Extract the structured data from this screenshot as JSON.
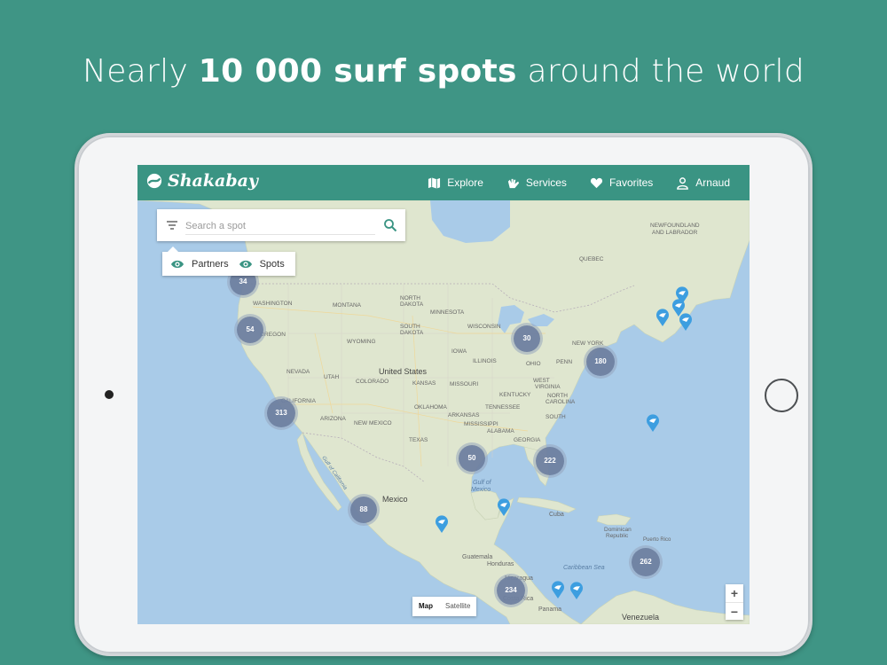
{
  "headline": {
    "pre": "Nearly ",
    "bold": "10 000 surf spots",
    "post": " around the world"
  },
  "app": {
    "brand": "Shakabay",
    "accent": "#3a9483"
  },
  "nav": [
    {
      "label": "Explore",
      "icon": "map-icon"
    },
    {
      "label": "Services",
      "icon": "surf-hand-icon"
    },
    {
      "label": "Favorites",
      "icon": "heart-icon"
    },
    {
      "label": "Arnaud",
      "icon": "user-icon"
    }
  ],
  "search": {
    "placeholder": "Search a spot"
  },
  "toggles": [
    {
      "label": "Partners",
      "icon": "eye-icon"
    },
    {
      "label": "Spots",
      "icon": "eye-icon"
    }
  ],
  "map_type": {
    "map": "Map",
    "satellite": "Satellite",
    "selected": "Map"
  },
  "zoom": {
    "in": "+",
    "out": "−"
  },
  "clusters": [
    "34",
    "54",
    "313",
    "30",
    "180",
    "50",
    "222",
    "88",
    "262",
    "234"
  ],
  "map_labels": {
    "newfoundland": "NEWFOUNDLAND",
    "labrador": "AND LABRADOR",
    "quebec": "QUEBEC",
    "washington": "WASHINGTON",
    "oregon": "OREGON",
    "montana": "MONTANA",
    "north_dakota": "NORTH",
    "north_dakota2": "DAKOTA",
    "south_dakota": "SOUTH",
    "south_dakota2": "DAKOTA",
    "minnesota": "MINNESOTA",
    "wisconsin": "WISCONSIN",
    "wyoming": "WYOMING",
    "nevada": "NEVADA",
    "utah": "UTAH",
    "colorado": "COLORADO",
    "kansas": "KANSAS",
    "iowa": "IOWA",
    "illinois": "ILLINOIS",
    "missouri": "MISSOURI",
    "ohio": "OHIO",
    "penn": "PENN",
    "new_york": "NEW YORK",
    "kentucky": "KENTUCKY",
    "west_virginia": "WEST",
    "virginia": "VIRGINIA",
    "tennessee": "TENNESSEE",
    "north_carolina": "NORTH",
    "carolina": "CAROLINA",
    "south_carolina": "SOUTH",
    "oklahoma": "OKLAHOMA",
    "arkansas": "ARKANSAS",
    "arizona": "ARIZONA",
    "new_mexico": "NEW MEXICO",
    "texas": "TEXAS",
    "mississippi": "MISSISSIPPI",
    "alabama": "ALABAMA",
    "georgia": "GEORGIA",
    "california": "CALIFORNIA",
    "united_states": "United States",
    "mexico": "Mexico",
    "gulf_california": "Gulf of California",
    "gulf_mexico": "Gulf of",
    "gulf_mexico2": "Mexico",
    "cuba": "Cuba",
    "dominican": "Dominican",
    "republic": "Republic",
    "puerto_rico": "Puerto Rico",
    "caribbean": "Caribbean Sea",
    "guatemala": "Guatemala",
    "honduras": "Honduras",
    "nicaragua": "Nicaragua",
    "costa_rica": "Costa Rica",
    "panama": "Panama",
    "venezuela": "Venezuela"
  }
}
